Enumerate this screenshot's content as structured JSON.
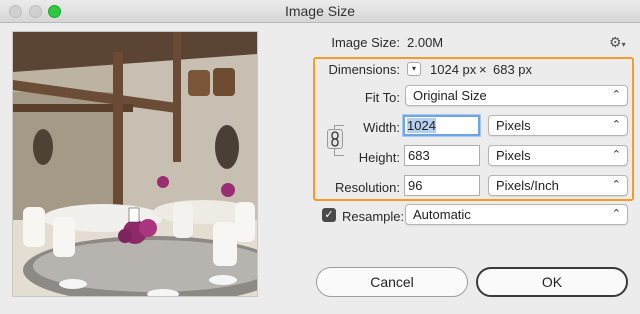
{
  "window": {
    "title": "Image Size"
  },
  "info": {
    "image_size_label": "Image Size:",
    "image_size_value": "2.00M"
  },
  "dimensions": {
    "label": "Dimensions:",
    "width_value": "1024 px",
    "times": "×",
    "height_value": "683 px"
  },
  "fit_to": {
    "label": "Fit To:",
    "selected": "Original Size"
  },
  "width": {
    "label": "Width:",
    "value": "1024",
    "unit": "Pixels"
  },
  "height": {
    "label": "Height:",
    "value": "683",
    "unit": "Pixels"
  },
  "resolution": {
    "label": "Resolution:",
    "value": "96",
    "unit": "Pixels/Inch"
  },
  "resample": {
    "label": "Resample:",
    "checked": true,
    "method": "Automatic"
  },
  "buttons": {
    "cancel": "Cancel",
    "ok": "OK"
  },
  "colors": {
    "accent_outline": "#f49b2a",
    "focus_ring": "#6ea5e5",
    "zoom_button": "#2fc840"
  },
  "icons": {
    "settings": "gear-icon",
    "link": "chain-link-icon",
    "dropdown": "chevron-updown-icon"
  }
}
